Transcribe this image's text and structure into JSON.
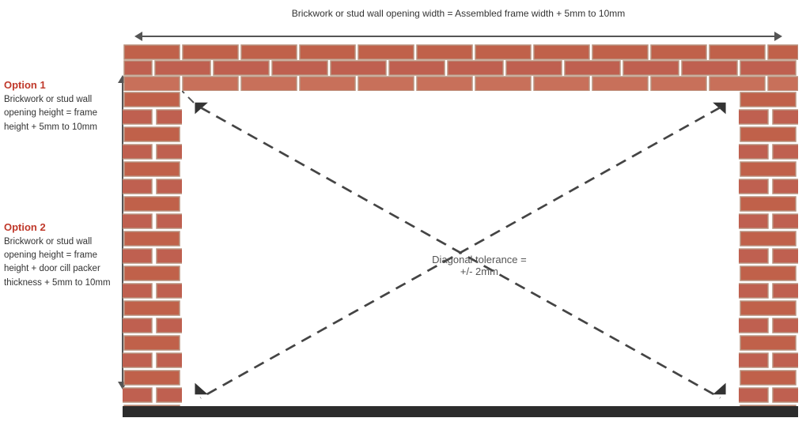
{
  "top_annotation": {
    "text": "Brickwork or stud wall opening width = Assembled frame width + 5mm to 10mm"
  },
  "option1": {
    "title": "Option 1",
    "text": "Brickwork or stud wall opening height = frame height + 5mm to 10mm"
  },
  "option2": {
    "title": "Option 2",
    "text": "Brickwork or stud wall opening height = frame height + door cill packer thickness + 5mm to 10mm"
  },
  "diagonal_label": {
    "line1": "Diagonal tolerance =",
    "line2": "+/- 2mm"
  },
  "colors": {
    "brick": "#c0614a",
    "brick_border": "#b8937f",
    "mortar": "#d4bdb5",
    "option_title": "#c0392b",
    "arrow": "#555555",
    "floor": "#2c2c2c"
  }
}
